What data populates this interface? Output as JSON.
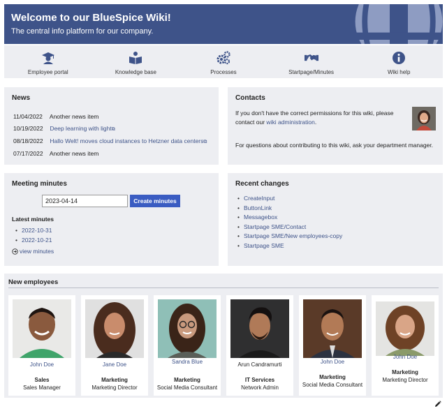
{
  "hero": {
    "title": "Welcome to our BlueSpice Wiki!",
    "subtitle": "The central info platform for our company."
  },
  "nav": [
    {
      "label": "Employee portal",
      "icon": "graduate-icon"
    },
    {
      "label": "Knowledge base",
      "icon": "book-reader-icon"
    },
    {
      "label": "Processes",
      "icon": "gears-icon"
    },
    {
      "label": "Startpage/Minutes",
      "icon": "handshake-icon"
    },
    {
      "label": "Wiki help",
      "icon": "info-icon"
    }
  ],
  "news": {
    "title": "News",
    "items": [
      {
        "date": "11/04/2022",
        "text": "Another news item",
        "link": false
      },
      {
        "date": "10/19/2022",
        "text": "Deep learning with light",
        "link": true
      },
      {
        "date": "08/18/2022",
        "text": "Hallo Welt! moves cloud instances to Hetzner data centers",
        "link": true
      },
      {
        "date": "07/17/2022",
        "text": "Another news item",
        "link": false
      }
    ]
  },
  "contacts": {
    "title": "Contacts",
    "text_before": "If you don't have the correct permissions for this wiki, please contact our ",
    "link": "wiki administration",
    "text_after": ".",
    "text2": "For questions about contributing to this wiki, ask your department manager."
  },
  "minutes": {
    "title": "Meeting minutes",
    "date_value": "2023-04-14",
    "button": "Create minutes",
    "latest_title": "Latest minutes",
    "items": [
      "2022-10-31",
      "2022-10-21"
    ],
    "view": "view minutes"
  },
  "changes": {
    "title": "Recent changes",
    "items": [
      "CreateInput",
      "ButtonLink",
      "Messagebox",
      "Startpage SME/Contact",
      "Startpage SME/New employees-copy",
      "Startpage SME"
    ]
  },
  "employees": {
    "title": "New employees",
    "items": [
      {
        "name": "John Doe",
        "dept": "Sales",
        "role": "Sales Manager"
      },
      {
        "name": "Jane Doe",
        "dept": "Marketing",
        "role": "Marketing Director"
      },
      {
        "name": "Sandra Blue",
        "dept": "Marketing",
        "role": "Social Media Consultant"
      },
      {
        "name": "Arun Candramurti",
        "dept": "IT Services",
        "role": "Network Admin"
      },
      {
        "name": "John Doe",
        "dept": "Marketing",
        "role": "Social Media Consultant"
      },
      {
        "name": "John Doe",
        "dept": "Marketing",
        "role": "Marketing Director"
      }
    ]
  },
  "colors": {
    "primary": "#3e5389",
    "button": "#3a5cc2",
    "panel": "#edeef2"
  }
}
